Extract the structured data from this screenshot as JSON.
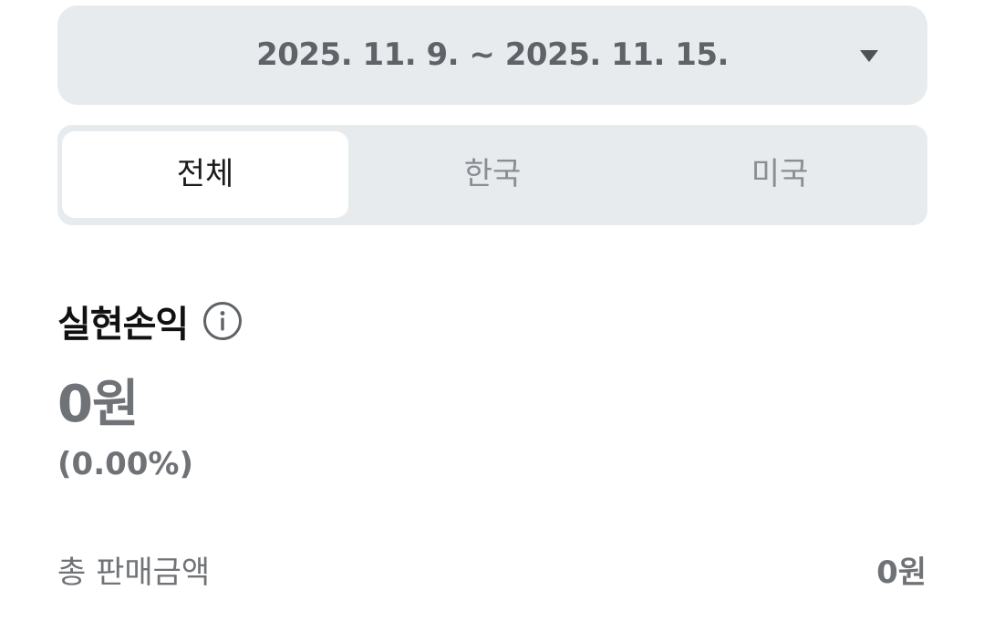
{
  "date_range": {
    "label": "2025. 11. 9. ~ 2025. 11. 15.",
    "icon": "caret-down-icon"
  },
  "tabs": [
    {
      "label": "전체",
      "selected": true
    },
    {
      "label": "한국",
      "selected": false
    },
    {
      "label": "미국",
      "selected": false
    }
  ],
  "realized_pnl": {
    "title": "실현손익",
    "info_icon": "info-icon",
    "amount": "0원",
    "percent": "(0.00%)"
  },
  "summary": {
    "total_sales_label": "총 판매금액",
    "total_sales_value": "0원"
  },
  "colors": {
    "panel_bg": "#e8ebee",
    "active_tab_bg": "#ffffff",
    "muted_text": "#6f7276",
    "title_text": "#111111"
  }
}
